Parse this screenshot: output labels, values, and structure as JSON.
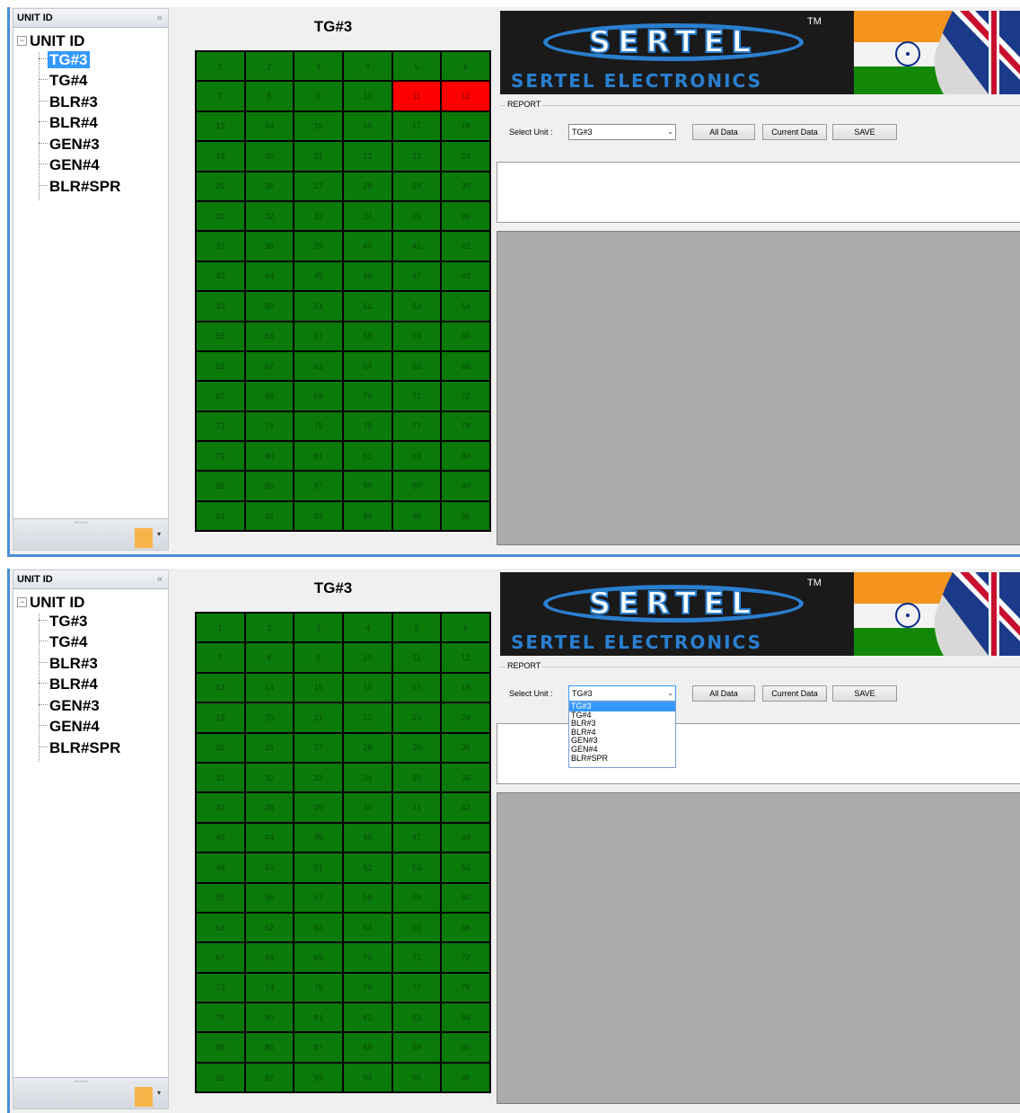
{
  "sidebar": {
    "header": "UNIT ID",
    "collapse_icon": "«",
    "root": "UNIT ID",
    "items": [
      "TG#3",
      "TG#4",
      "BLR#3",
      "BLR#4",
      "GEN#3",
      "GEN#4",
      "BLR#SPR"
    ]
  },
  "grid": {
    "title": "TG#3",
    "cells": [
      1,
      2,
      3,
      4,
      5,
      6,
      7,
      8,
      9,
      10,
      11,
      12,
      13,
      14,
      15,
      16,
      17,
      18,
      19,
      20,
      21,
      22,
      23,
      24,
      25,
      26,
      27,
      28,
      29,
      30,
      31,
      32,
      33,
      34,
      35,
      36,
      37,
      38,
      39,
      40,
      41,
      42,
      43,
      44,
      45,
      46,
      47,
      48,
      49,
      50,
      51,
      52,
      53,
      54,
      55,
      56,
      57,
      58,
      59,
      60,
      61,
      62,
      63,
      64,
      65,
      66,
      67,
      68,
      69,
      70,
      71,
      72,
      73,
      74,
      75,
      76,
      77,
      78,
      79,
      80,
      81,
      82,
      83,
      84,
      85,
      86,
      87,
      88,
      89,
      90,
      91,
      92,
      93,
      94,
      95,
      96
    ],
    "alarm_cells_view1": [
      11,
      12
    ],
    "colors": {
      "normal": "#0b7a0b",
      "alarm": "#ff0000"
    }
  },
  "banner": {
    "logo": "SERTEL",
    "trademark": "TM",
    "subtitle": "SERTEL ELECTRONICS"
  },
  "report": {
    "legend": "REPORT",
    "select_label": "Select Unit :",
    "selected_unit": "TG#3",
    "options": [
      "TG#3",
      "TG#4",
      "BLR#3",
      "BLR#4",
      "GEN#3",
      "GEN#4",
      "BLR#SPR"
    ],
    "buttons": {
      "all_data": "All Data",
      "current_data": "Current Data",
      "save": "SAVE"
    }
  }
}
